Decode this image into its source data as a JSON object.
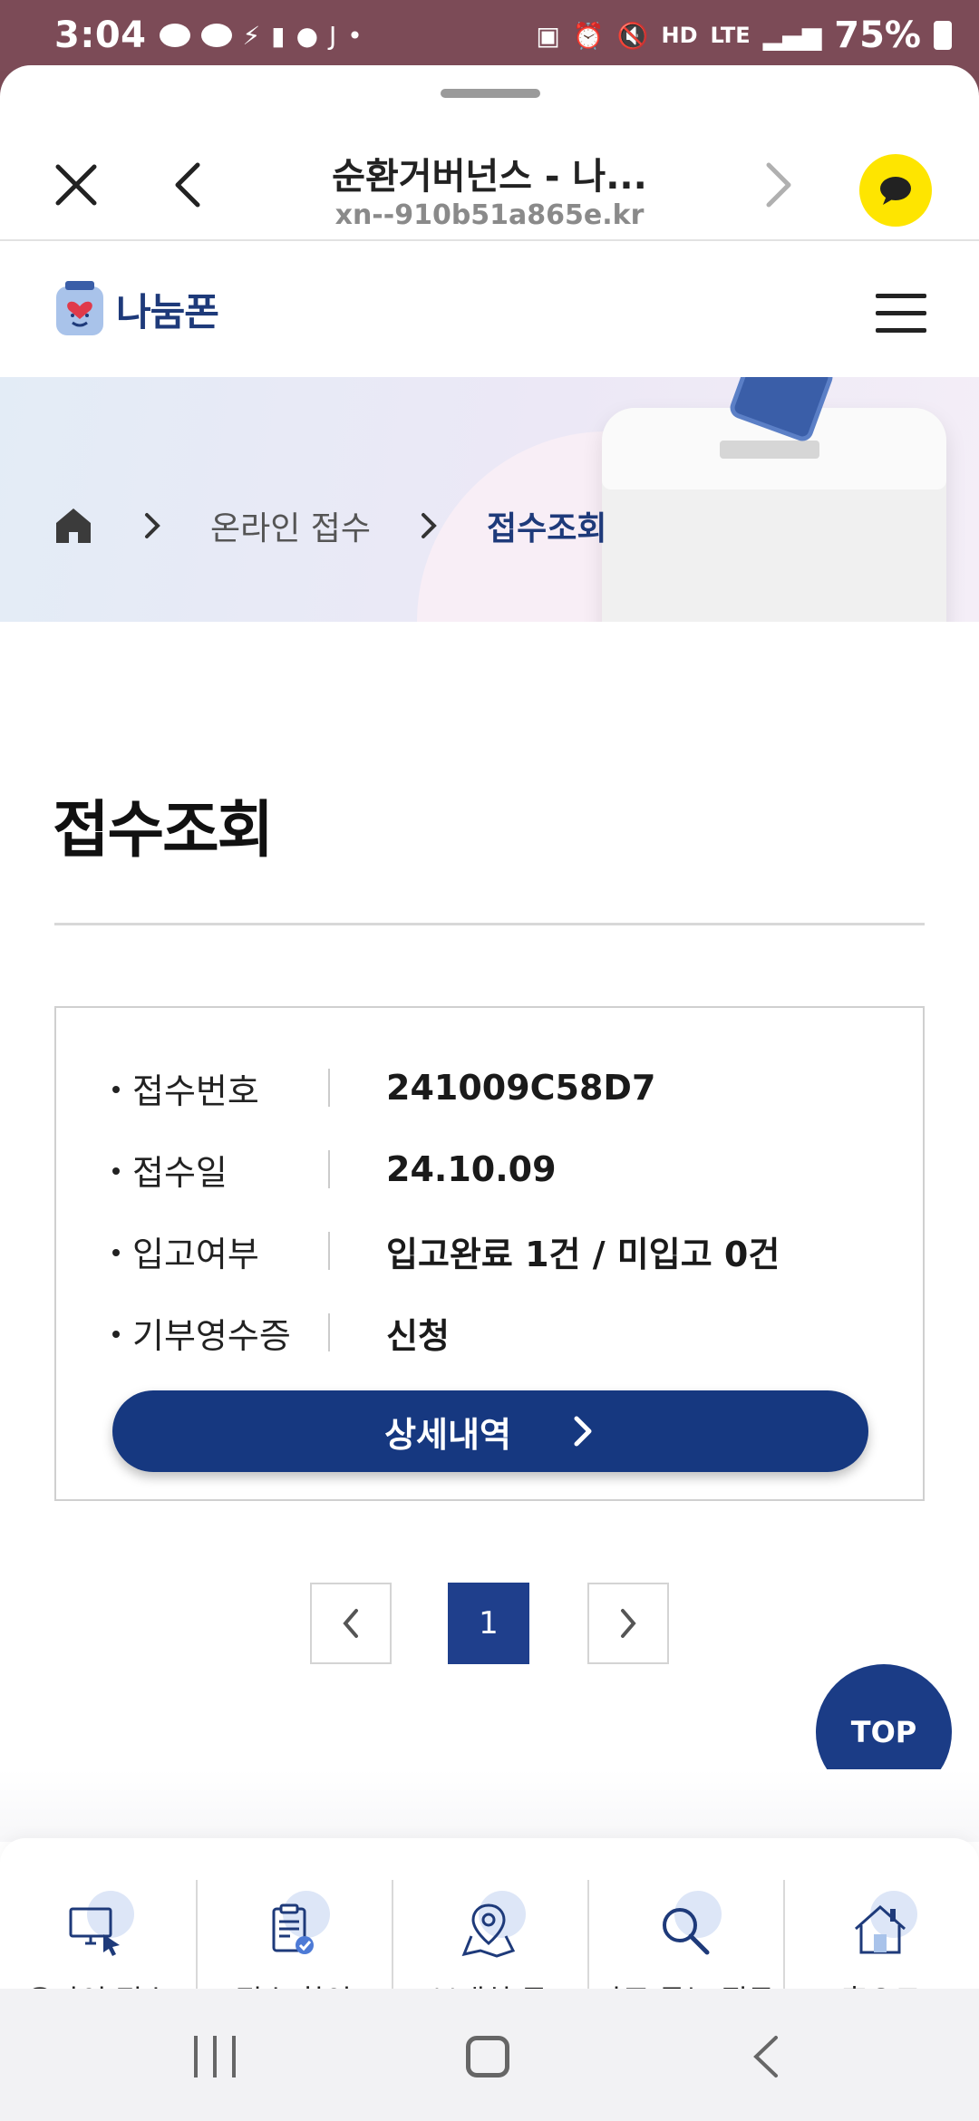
{
  "status_bar": {
    "time": "3:04",
    "battery": "75%",
    "network": "LTE",
    "hd": "HD"
  },
  "browser": {
    "title": "순환거버넌스 - 나...",
    "url": "xn--910b51a865e.kr"
  },
  "site": {
    "logo_text": "나눔폰"
  },
  "breadcrumb": {
    "items": [
      "온라인 접수",
      "접수조회"
    ]
  },
  "page": {
    "title": "접수조회"
  },
  "receipt": {
    "rows": [
      {
        "label": "접수번호",
        "value": "241009C58D7"
      },
      {
        "label": "접수일",
        "value": "24.10.09"
      },
      {
        "label": "입고여부",
        "value": "입고완료 1건 / 미입고 0건"
      },
      {
        "label": "기부영수증",
        "value": "신청"
      }
    ],
    "detail_button": "상세내역"
  },
  "pagination": {
    "current": "1"
  },
  "top_button": "TOP",
  "bottom_nav": [
    {
      "label": "온라인 접수",
      "icon": "monitor-cursor-icon"
    },
    {
      "label": "접수 확인",
      "icon": "clipboard-check-icon"
    },
    {
      "label": "보내실 곳",
      "icon": "map-pin-icon"
    },
    {
      "label": "자주 묻는 질문",
      "icon": "search-icon"
    },
    {
      "label": "홈으로",
      "icon": "house-icon"
    }
  ],
  "colors": {
    "primary": "#163880",
    "status_bar": "#7c4b57",
    "kakao": "#fee500"
  }
}
